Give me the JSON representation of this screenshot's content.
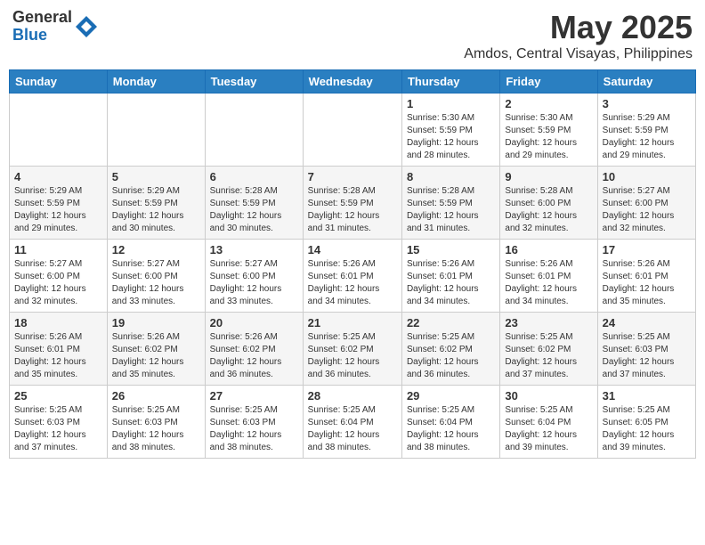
{
  "header": {
    "logo_general": "General",
    "logo_blue": "Blue",
    "month_title": "May 2025",
    "location": "Amdos, Central Visayas, Philippines"
  },
  "days_of_week": [
    "Sunday",
    "Monday",
    "Tuesday",
    "Wednesday",
    "Thursday",
    "Friday",
    "Saturday"
  ],
  "weeks": [
    [
      {
        "day": "",
        "info": ""
      },
      {
        "day": "",
        "info": ""
      },
      {
        "day": "",
        "info": ""
      },
      {
        "day": "",
        "info": ""
      },
      {
        "day": "1",
        "info": "Sunrise: 5:30 AM\nSunset: 5:59 PM\nDaylight: 12 hours\nand 28 minutes."
      },
      {
        "day": "2",
        "info": "Sunrise: 5:30 AM\nSunset: 5:59 PM\nDaylight: 12 hours\nand 29 minutes."
      },
      {
        "day": "3",
        "info": "Sunrise: 5:29 AM\nSunset: 5:59 PM\nDaylight: 12 hours\nand 29 minutes."
      }
    ],
    [
      {
        "day": "4",
        "info": "Sunrise: 5:29 AM\nSunset: 5:59 PM\nDaylight: 12 hours\nand 29 minutes."
      },
      {
        "day": "5",
        "info": "Sunrise: 5:29 AM\nSunset: 5:59 PM\nDaylight: 12 hours\nand 30 minutes."
      },
      {
        "day": "6",
        "info": "Sunrise: 5:28 AM\nSunset: 5:59 PM\nDaylight: 12 hours\nand 30 minutes."
      },
      {
        "day": "7",
        "info": "Sunrise: 5:28 AM\nSunset: 5:59 PM\nDaylight: 12 hours\nand 31 minutes."
      },
      {
        "day": "8",
        "info": "Sunrise: 5:28 AM\nSunset: 5:59 PM\nDaylight: 12 hours\nand 31 minutes."
      },
      {
        "day": "9",
        "info": "Sunrise: 5:28 AM\nSunset: 6:00 PM\nDaylight: 12 hours\nand 32 minutes."
      },
      {
        "day": "10",
        "info": "Sunrise: 5:27 AM\nSunset: 6:00 PM\nDaylight: 12 hours\nand 32 minutes."
      }
    ],
    [
      {
        "day": "11",
        "info": "Sunrise: 5:27 AM\nSunset: 6:00 PM\nDaylight: 12 hours\nand 32 minutes."
      },
      {
        "day": "12",
        "info": "Sunrise: 5:27 AM\nSunset: 6:00 PM\nDaylight: 12 hours\nand 33 minutes."
      },
      {
        "day": "13",
        "info": "Sunrise: 5:27 AM\nSunset: 6:00 PM\nDaylight: 12 hours\nand 33 minutes."
      },
      {
        "day": "14",
        "info": "Sunrise: 5:26 AM\nSunset: 6:01 PM\nDaylight: 12 hours\nand 34 minutes."
      },
      {
        "day": "15",
        "info": "Sunrise: 5:26 AM\nSunset: 6:01 PM\nDaylight: 12 hours\nand 34 minutes."
      },
      {
        "day": "16",
        "info": "Sunrise: 5:26 AM\nSunset: 6:01 PM\nDaylight: 12 hours\nand 34 minutes."
      },
      {
        "day": "17",
        "info": "Sunrise: 5:26 AM\nSunset: 6:01 PM\nDaylight: 12 hours\nand 35 minutes."
      }
    ],
    [
      {
        "day": "18",
        "info": "Sunrise: 5:26 AM\nSunset: 6:01 PM\nDaylight: 12 hours\nand 35 minutes."
      },
      {
        "day": "19",
        "info": "Sunrise: 5:26 AM\nSunset: 6:02 PM\nDaylight: 12 hours\nand 35 minutes."
      },
      {
        "day": "20",
        "info": "Sunrise: 5:26 AM\nSunset: 6:02 PM\nDaylight: 12 hours\nand 36 minutes."
      },
      {
        "day": "21",
        "info": "Sunrise: 5:25 AM\nSunset: 6:02 PM\nDaylight: 12 hours\nand 36 minutes."
      },
      {
        "day": "22",
        "info": "Sunrise: 5:25 AM\nSunset: 6:02 PM\nDaylight: 12 hours\nand 36 minutes."
      },
      {
        "day": "23",
        "info": "Sunrise: 5:25 AM\nSunset: 6:02 PM\nDaylight: 12 hours\nand 37 minutes."
      },
      {
        "day": "24",
        "info": "Sunrise: 5:25 AM\nSunset: 6:03 PM\nDaylight: 12 hours\nand 37 minutes."
      }
    ],
    [
      {
        "day": "25",
        "info": "Sunrise: 5:25 AM\nSunset: 6:03 PM\nDaylight: 12 hours\nand 37 minutes."
      },
      {
        "day": "26",
        "info": "Sunrise: 5:25 AM\nSunset: 6:03 PM\nDaylight: 12 hours\nand 38 minutes."
      },
      {
        "day": "27",
        "info": "Sunrise: 5:25 AM\nSunset: 6:03 PM\nDaylight: 12 hours\nand 38 minutes."
      },
      {
        "day": "28",
        "info": "Sunrise: 5:25 AM\nSunset: 6:04 PM\nDaylight: 12 hours\nand 38 minutes."
      },
      {
        "day": "29",
        "info": "Sunrise: 5:25 AM\nSunset: 6:04 PM\nDaylight: 12 hours\nand 38 minutes."
      },
      {
        "day": "30",
        "info": "Sunrise: 5:25 AM\nSunset: 6:04 PM\nDaylight: 12 hours\nand 39 minutes."
      },
      {
        "day": "31",
        "info": "Sunrise: 5:25 AM\nSunset: 6:05 PM\nDaylight: 12 hours\nand 39 minutes."
      }
    ]
  ]
}
